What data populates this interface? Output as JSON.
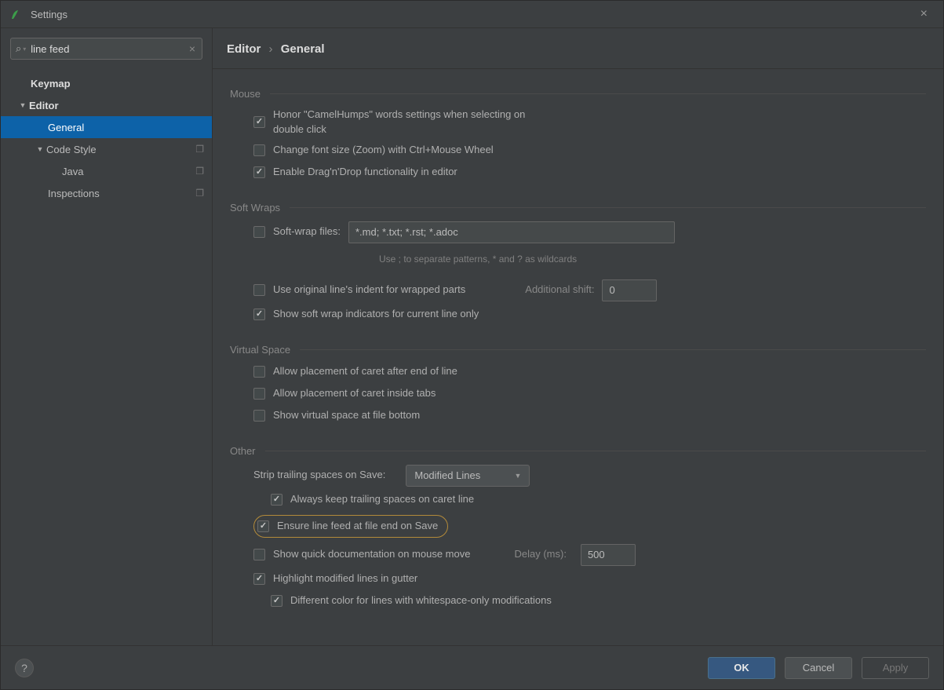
{
  "window": {
    "title": "Settings"
  },
  "search": {
    "value": "line feed"
  },
  "sidebar": {
    "items": {
      "keymap": "Keymap",
      "editor": "Editor",
      "general": "General",
      "code_style": "Code Style",
      "java": "Java",
      "inspections": "Inspections"
    }
  },
  "breadcrumb": {
    "a": "Editor",
    "b": "General"
  },
  "sections": {
    "mouse": {
      "title": "Mouse",
      "camelhumps": "Honor \"CamelHumps\" words settings when selecting on double click",
      "zoom": "Change font size (Zoom) with Ctrl+Mouse Wheel",
      "dnd": "Enable Drag'n'Drop functionality in editor"
    },
    "softwraps": {
      "title": "Soft Wraps",
      "files_label": "Soft-wrap files:",
      "files_value": "*.md; *.txt; *.rst; *.adoc",
      "hint": "Use ; to separate patterns, * and ? as wildcards",
      "original_indent": "Use original line's indent for wrapped parts",
      "additional_shift_label": "Additional shift:",
      "additional_shift_value": "0",
      "indicators": "Show soft wrap indicators for current line only"
    },
    "virtual": {
      "title": "Virtual Space",
      "after_eol": "Allow placement of caret after end of line",
      "inside_tabs": "Allow placement of caret inside tabs",
      "file_bottom": "Show virtual space at file bottom"
    },
    "other": {
      "title": "Other",
      "strip_label": "Strip trailing spaces on Save:",
      "strip_value": "Modified Lines",
      "keep_caret": "Always keep trailing spaces on caret line",
      "line_feed": "Ensure line feed at file end on Save",
      "quick_doc": "Show quick documentation on mouse move",
      "delay_label": "Delay (ms):",
      "delay_value": "500",
      "highlight_gutter": "Highlight modified lines in gutter",
      "diff_color": "Different color for lines with whitespace-only modifications"
    }
  },
  "footer": {
    "ok": "OK",
    "cancel": "Cancel",
    "apply": "Apply"
  }
}
